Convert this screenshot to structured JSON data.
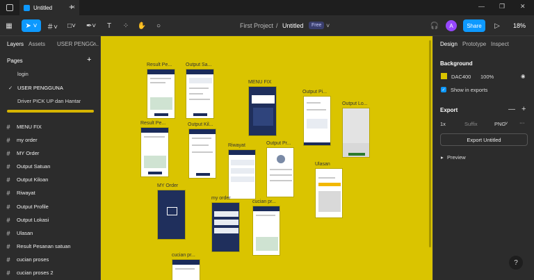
{
  "tab": {
    "title": "Untitled"
  },
  "toolbar": {
    "project": "First Project",
    "separator": "/",
    "file": "Untitled",
    "plan": "Free",
    "share": "Share",
    "avatar": "A",
    "zoom": "18%"
  },
  "left_panel": {
    "tabs": [
      "Layers",
      "Assets",
      "USER PENGG..."
    ],
    "pages_title": "Pages",
    "pages": [
      "login",
      "USER PENGGUNA",
      "Driver PICK UP dan Hantar"
    ],
    "layers": [
      "MENU FIX",
      "my order",
      "MY Order",
      "Output Satuan",
      "Output Kiloan",
      "Riwayat",
      "Output Profile",
      "Output Lokasi",
      "Ulasan",
      "Result Pesanan satuan",
      "cucian proses",
      "cucian proses 2"
    ]
  },
  "canvas": {
    "frames": [
      "Result Pe...",
      "Output Sa...",
      "MENU FIX",
      "Output Pi...",
      "Output Lo...",
      "Result Pe...",
      "Output Kil...",
      "Riwayat",
      "Output Pr...",
      "Ulasan",
      "MY Order",
      "my order",
      "cucian pr...",
      "cucian pr..."
    ]
  },
  "right_panel": {
    "tabs": [
      "Design",
      "Prototype",
      "Inspect"
    ],
    "background_title": "Background",
    "bg_hex": "DAC400",
    "bg_opacity": "100%",
    "show_exports": "Show in exports",
    "export_title": "Export",
    "export_scale": "1x",
    "export_suffix": "Suffix",
    "export_format": "PNG",
    "export_button": "Export Untitled",
    "preview": "Preview"
  },
  "colors": {
    "canvas": "#dac400",
    "accent": "#0d99ff",
    "frame_dark": "#1f2f5c"
  },
  "help": "?"
}
